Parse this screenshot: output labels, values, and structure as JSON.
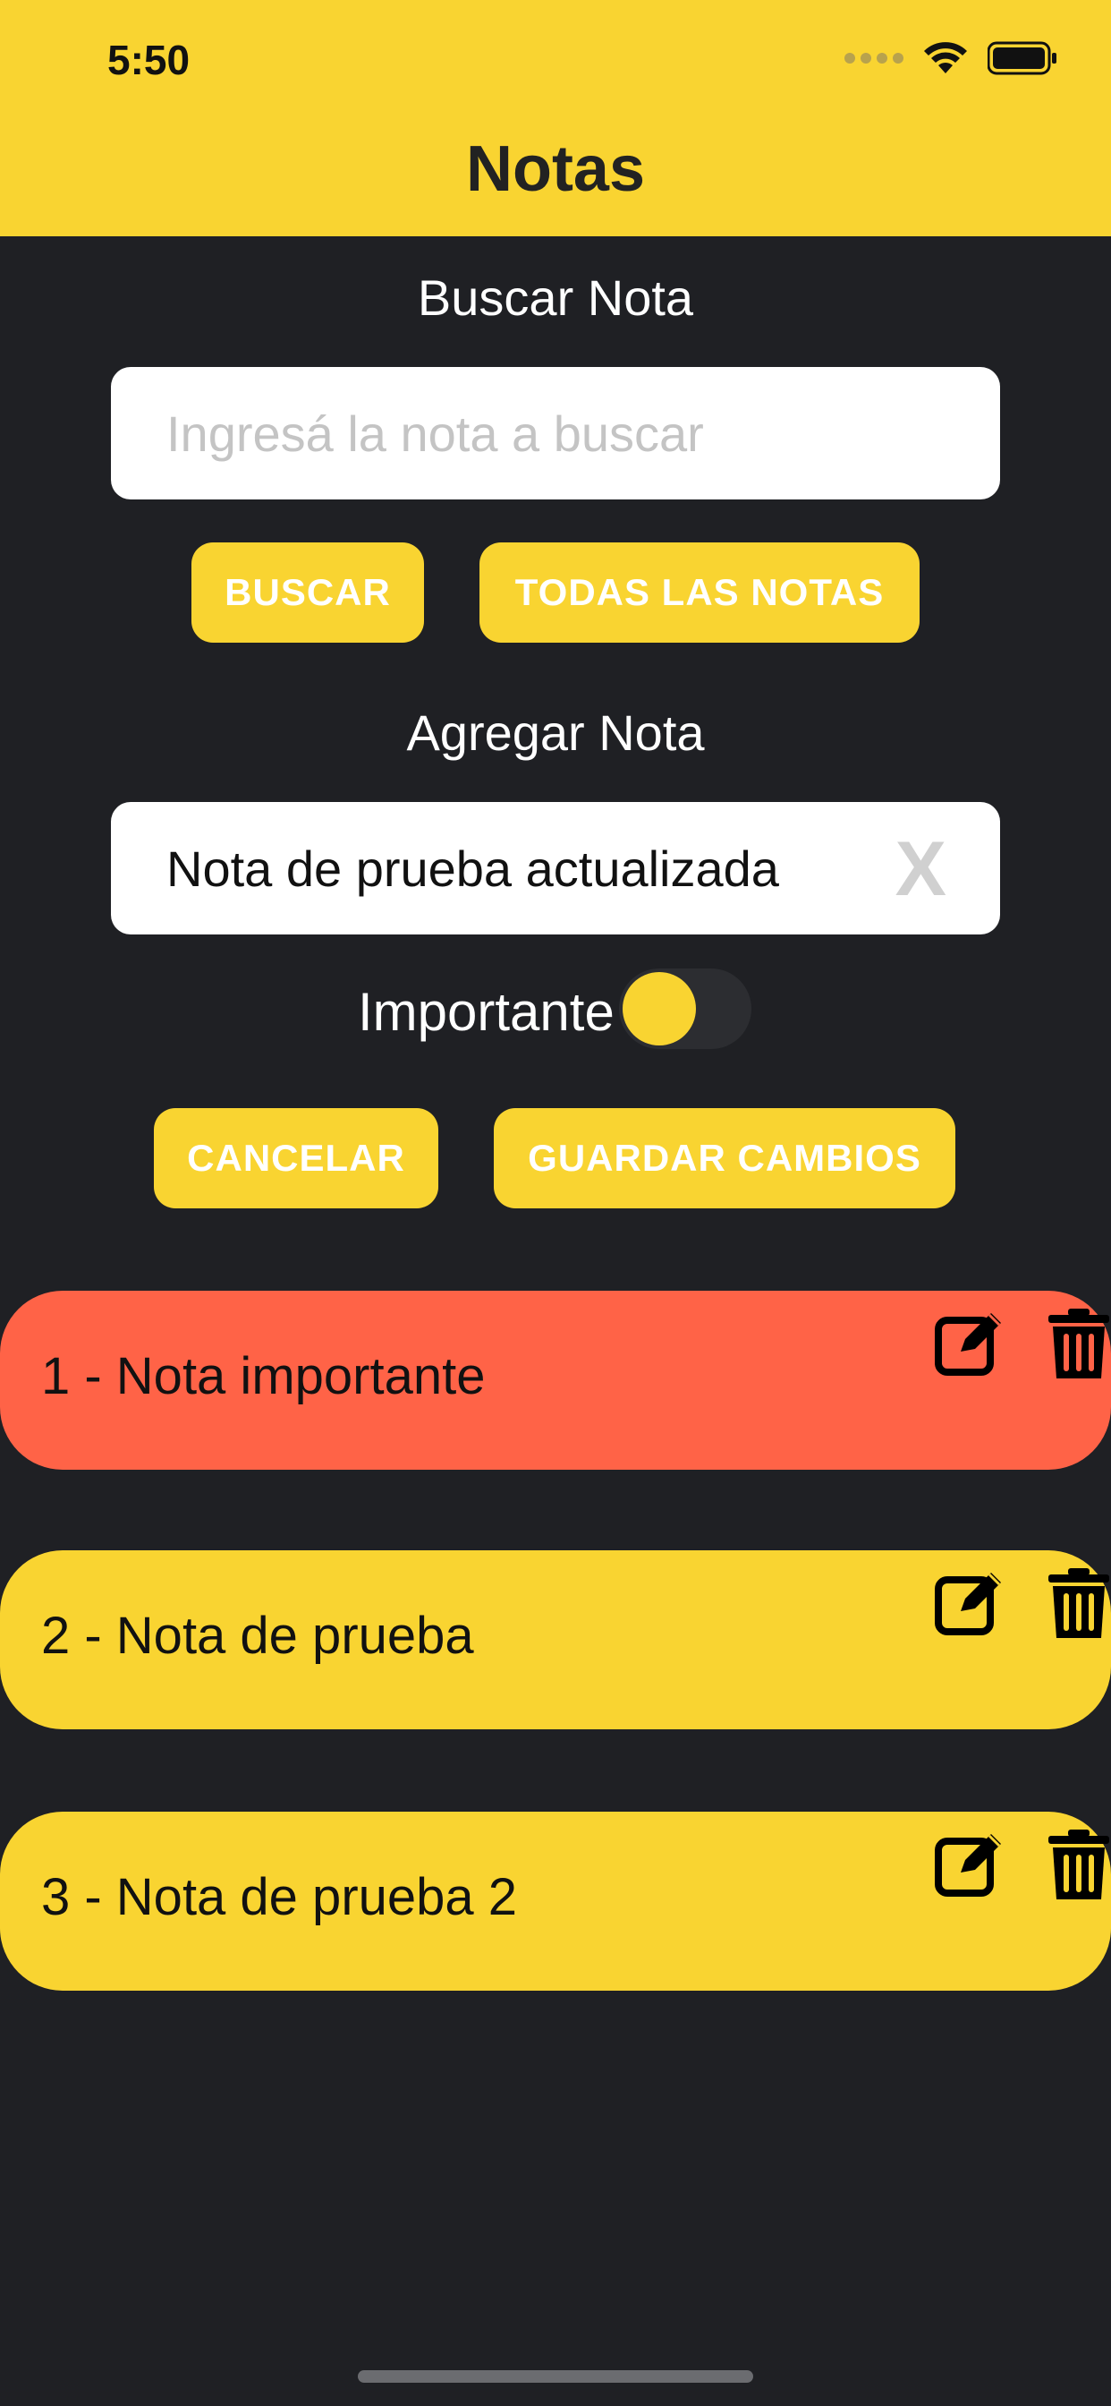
{
  "status_bar": {
    "time": "5:50"
  },
  "header": {
    "title": "Notas"
  },
  "search": {
    "label": "Buscar Nota",
    "placeholder": "Ingresá la nota a buscar",
    "search_button": "BUSCAR",
    "all_button": "TODAS LAS NOTAS"
  },
  "add": {
    "label": "Agregar Nota",
    "value": "Nota de prueba actualizada",
    "clear_label": "X",
    "important_label": "Importante",
    "cancel_button": "CANCELAR",
    "save_button": "GUARDAR CAMBIOS"
  },
  "notes": [
    {
      "text": "1 - Nota importante",
      "color": "#ff6347"
    },
    {
      "text": "2 - Nota de prueba",
      "color": "#f9d431"
    },
    {
      "text": "3 - Nota de prueba 2",
      "color": "#f9d431"
    }
  ],
  "colors": {
    "accent": "#f9d431",
    "background": "#1f2024",
    "important": "#ff6347"
  }
}
